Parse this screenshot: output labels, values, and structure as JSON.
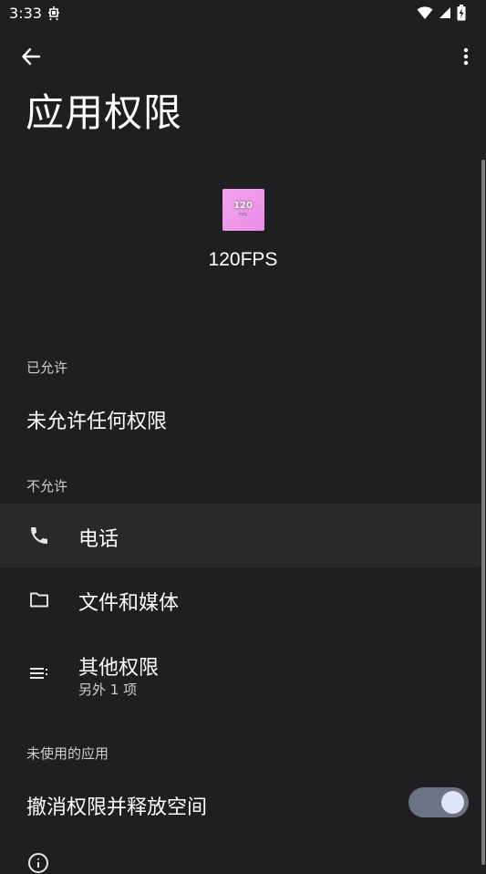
{
  "status_bar": {
    "time": "3:33"
  },
  "app_bar": {
    "title": "应用权限"
  },
  "app": {
    "icon_text": "120",
    "icon_subtext": "FPS",
    "name": "120FPS"
  },
  "sections": {
    "allowed_header": "已允许",
    "allowed_empty": "未允许任何权限",
    "denied_header": "不允许",
    "unused_header": "未使用的应用"
  },
  "permissions": [
    {
      "label": "电话",
      "icon": "phone-icon",
      "sublabel": ""
    },
    {
      "label": "文件和媒体",
      "icon": "folder-icon",
      "sublabel": ""
    },
    {
      "label": "其他权限",
      "icon": "list-icon",
      "sublabel": "另外 1 项"
    }
  ],
  "unused": {
    "toggle_label": "撤消权限并释放空间",
    "toggle_on": true
  },
  "colors": {
    "background": "#1f1f21",
    "highlight": "#29292b",
    "toggle_track": "#6d7285",
    "toggle_knob": "#dfe4f7",
    "icon_bg": "#f5a2f0"
  }
}
